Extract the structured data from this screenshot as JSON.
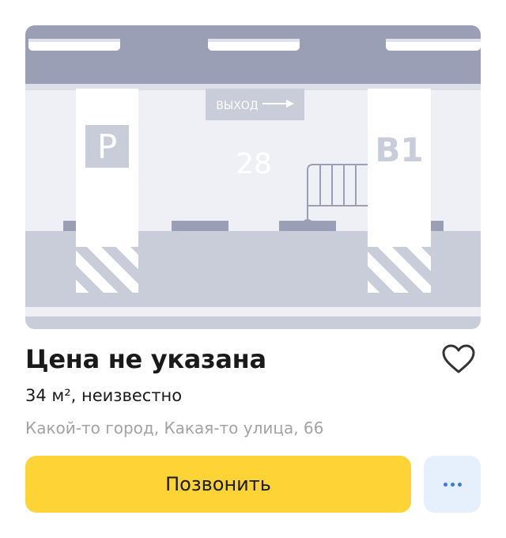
{
  "listing": {
    "price": "Цена не указана",
    "details": "34 м², неизвестно",
    "address": "Какой-то город, Какая-то улица, 66"
  },
  "photo": {
    "exit_sign": "ВЫХОД",
    "spot_number": "28",
    "parking_sign": "P",
    "level_sign": "B1"
  },
  "actions": {
    "call_label": "Позвонить",
    "favorite_icon": "heart-outline-icon",
    "more_icon": "more-dots-icon"
  },
  "colors": {
    "call_button": "#fdd336",
    "more_button_bg": "#e5f0fc",
    "more_dots": "#3a7bd5",
    "address_text": "#a3a3a3"
  }
}
